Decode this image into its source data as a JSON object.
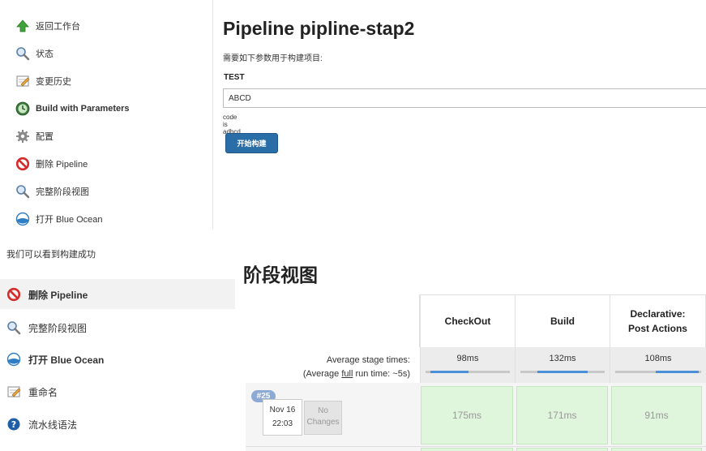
{
  "top_sidebar": {
    "items": [
      {
        "label": "返回工作台",
        "icon": "up-arrow-icon"
      },
      {
        "label": "状态",
        "icon": "magnifier-icon"
      },
      {
        "label": "变更历史",
        "icon": "notepad-icon"
      },
      {
        "label": "Build with Parameters",
        "icon": "build-clock-icon"
      },
      {
        "label": "配置",
        "icon": "gear-icon"
      },
      {
        "label": "删除 Pipeline",
        "icon": "no-sign-icon"
      },
      {
        "label": "完整阶段视图",
        "icon": "magnifier-icon"
      },
      {
        "label": "打开 Blue Ocean",
        "icon": "blue-ocean-icon"
      }
    ]
  },
  "build_form": {
    "title": "Pipeline pipline-stap2",
    "description": "需要如下参数用于构建项目:",
    "param_name": "TEST",
    "param_value": "ABCD",
    "param_help": "code is adbcd",
    "build_button": "开始构建"
  },
  "caption": "我们可以看到构建成功",
  "bottom_sidebar": {
    "items": [
      {
        "label": "删除 Pipeline",
        "icon": "no-sign-icon"
      },
      {
        "label": "完整阶段视图",
        "icon": "magnifier-icon"
      },
      {
        "label": "打开 Blue Ocean",
        "icon": "blue-ocean-icon"
      },
      {
        "label": "重命名",
        "icon": "notepad-icon"
      },
      {
        "label": "流水线语法",
        "icon": "help-icon"
      }
    ]
  },
  "stage_view": {
    "heading": "阶段视图",
    "stages": [
      {
        "name_line1": "CheckOut",
        "name_line2": "",
        "avg_time": "98ms",
        "avg_fraction": 0.45,
        "run_time": "175ms"
      },
      {
        "name_line1": "Build",
        "name_line2": "",
        "avg_time": "132ms",
        "avg_fraction": 0.6,
        "run_time": "171ms"
      },
      {
        "name_line1": "Declarative:",
        "name_line2": "Post Actions",
        "avg_time": "108ms",
        "avg_fraction": 0.5,
        "run_time": "91ms"
      }
    ],
    "avg_label_line1": "Average stage times:",
    "avg_label_prefix": "(Average ",
    "avg_label_full": "full",
    "avg_label_suffix": " run time: ~5s)",
    "run": {
      "number": "#25",
      "date": "Nov 16",
      "time": "22:03",
      "changes_line1": "No",
      "changes_line2": "Changes"
    }
  },
  "colors": {
    "build_button": "#2a6ea8",
    "stage_success": "#dff5dc",
    "run_badge": "#8daad4",
    "progress_bar": "#4a90d9"
  }
}
